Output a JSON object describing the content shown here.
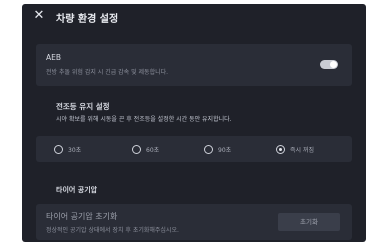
{
  "dialog": {
    "close_label": "✕",
    "title": "차량 환경 설정"
  },
  "aeb": {
    "title": "AEB",
    "description": "전방 추돌 위험 감지 시 긴급 감속 및 제동합니다.",
    "enabled": true
  },
  "headlight_delay": {
    "title": "전조등 유지 설정",
    "description": "시야 확보를 위해 시동을 끈 후 전조등을 설정한 시간 동안 유지합니다.",
    "options": [
      "30초",
      "60초",
      "90초",
      "즉시 꺼짐"
    ],
    "selected": "즉시 꺼짐"
  },
  "tire_pressure": {
    "section_title": "타이어 공기압",
    "title": "타이어 공기압 초기화",
    "description": "정상적인 공기압 상태에서 장치 후 초기화해주십시오.",
    "button_label": "초기화"
  }
}
